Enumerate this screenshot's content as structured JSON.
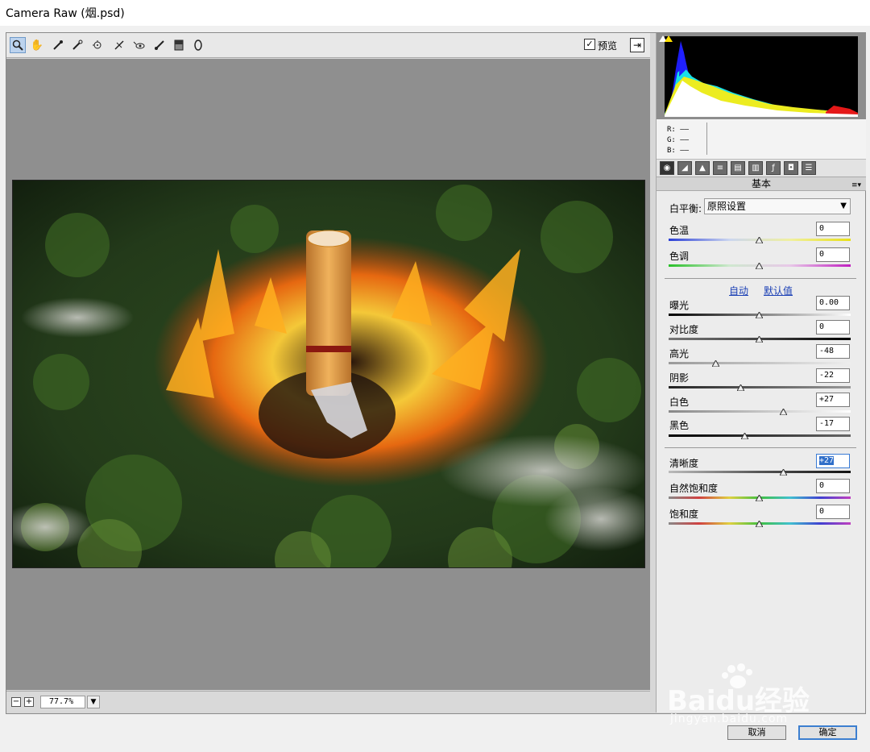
{
  "window": {
    "title": "Camera Raw (烟.psd)"
  },
  "toolbar": {
    "tools": [
      "zoom-icon",
      "hand-icon",
      "white-balance-icon",
      "color-sampler-icon",
      "target-adjust-icon",
      "crop-icon",
      "straighten-icon",
      "spot-removal-icon",
      "red-eye-icon",
      "adjustment-brush-icon",
      "graduated-filter-icon",
      "radial-filter-icon"
    ],
    "preview_label": "预览",
    "preview_checked": true
  },
  "zoom": {
    "value": "77.7%"
  },
  "histogram": {
    "r": "R: ——",
    "g": "G: ——",
    "b": "B: ——"
  },
  "panel": {
    "title": "基本",
    "white_balance_label": "白平衡:",
    "white_balance_value": "原照设置",
    "temp_label": "色温",
    "temp_value": "0",
    "tint_label": "色调",
    "tint_value": "0",
    "auto_label": "自动",
    "default_label": "默认值",
    "exposure_label": "曝光",
    "exposure_value": "0.00",
    "contrast_label": "对比度",
    "contrast_value": "0",
    "highlights_label": "高光",
    "highlights_value": "-48",
    "shadows_label": "阴影",
    "shadows_value": "-22",
    "whites_label": "白色",
    "whites_value": "+27",
    "blacks_label": "黑色",
    "blacks_value": "-17",
    "clarity_label": "清晰度",
    "clarity_value": "+27",
    "vibrance_label": "自然饱和度",
    "vibrance_value": "0",
    "saturation_label": "饱和度",
    "saturation_value": "0"
  },
  "buttons": {
    "cancel": "取消",
    "ok": "确定"
  },
  "watermark": {
    "brand": "Baidu经验",
    "url": "jingyan.baidu.com"
  }
}
